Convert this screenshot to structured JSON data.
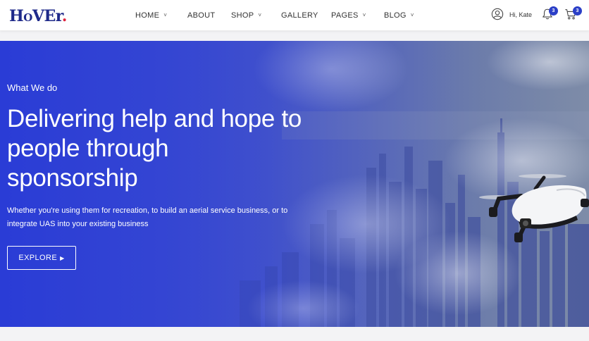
{
  "brand": {
    "logo_text_big1": "H",
    "logo_text_small": "O",
    "logo_text_big2": "VEr",
    "logo_dot": "."
  },
  "nav": {
    "items": [
      {
        "label": "HOME",
        "has_dropdown": true
      },
      {
        "label": "ABOUT",
        "has_dropdown": false
      },
      {
        "label": "SHOP",
        "has_dropdown": true
      },
      {
        "label": "GALLERY",
        "has_dropdown": false
      },
      {
        "label": "PAGES",
        "has_dropdown": true
      },
      {
        "label": "BLOG",
        "has_dropdown": true
      }
    ],
    "chevron": "˅"
  },
  "user": {
    "greeting": "Hi, Kate",
    "icon": "user-icon"
  },
  "notifications": {
    "icon": "bell-icon",
    "count": "3"
  },
  "cart": {
    "icon": "cart-icon",
    "count": "3"
  },
  "hero": {
    "eyebrow": "What We do",
    "headline": "Delivering help and hope to people through sponsorship",
    "lead": "Whether you're using them for recreation, to build an aerial service business, or to integrate UAS into your existing business",
    "cta_label": "EXPLORE",
    "cta_arrow": "▶"
  },
  "colors": {
    "accent": "#2b3fc7",
    "hero_blue": "#2a3cd6",
    "logo_navy": "#1f2a8a",
    "logo_red": "#e0233d"
  }
}
